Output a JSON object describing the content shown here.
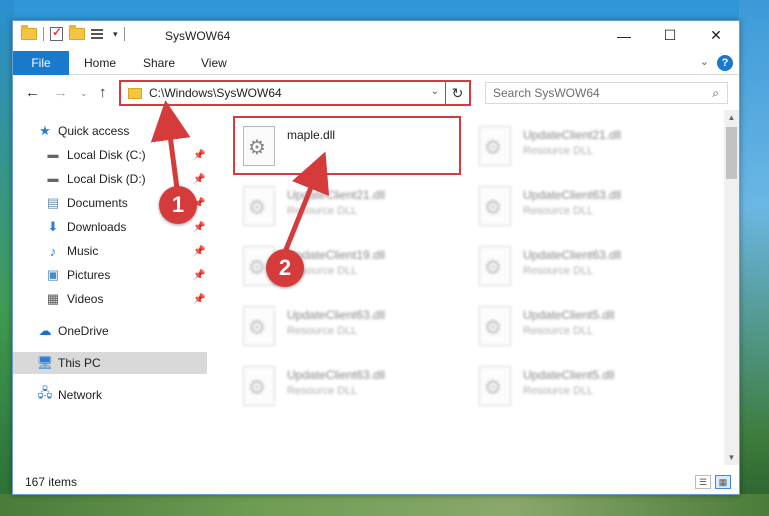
{
  "window": {
    "title": "SysWOW64",
    "controls": {
      "minimize": "—",
      "maximize": "☐",
      "close": "✕"
    }
  },
  "ribbon": {
    "tabs": [
      "File",
      "Home",
      "Share",
      "View"
    ],
    "collapse": "⌄",
    "help": "?"
  },
  "nav": {
    "back": "←",
    "forward": "→",
    "recent": "⌄",
    "up": "↑"
  },
  "address": {
    "path": "C:\\Windows\\SysWOW64",
    "dropdown": "⌄",
    "refresh": "↻"
  },
  "search": {
    "placeholder": "Search SysWOW64"
  },
  "sidebar": {
    "items": [
      {
        "label": "Quick access",
        "icon": "star-icon"
      },
      {
        "label": "Local Disk (C:)",
        "icon": "drive-icon"
      },
      {
        "label": "Local Disk (D:)",
        "icon": "drive-icon"
      },
      {
        "label": "Documents",
        "icon": "documents-icon"
      },
      {
        "label": "Downloads",
        "icon": "download-icon"
      },
      {
        "label": "Music",
        "icon": "music-icon"
      },
      {
        "label": "Pictures",
        "icon": "pictures-icon"
      },
      {
        "label": "Videos",
        "icon": "videos-icon"
      },
      {
        "label": "OneDrive",
        "icon": "cloud-icon"
      },
      {
        "label": "This PC",
        "icon": "computer-icon",
        "selected": true
      },
      {
        "label": "Network",
        "icon": "network-icon"
      }
    ]
  },
  "files": [
    {
      "name": "maple.dll",
      "type": ""
    },
    {
      "name": "UpdateClient21.dll",
      "type": "Resource DLL"
    },
    {
      "name": "UpdateClient21.dll",
      "type": "Resource DLL"
    },
    {
      "name": "UpdateClient63.dll",
      "type": "Resource DLL"
    },
    {
      "name": "UpdateClient19.dll",
      "type": "Resource DLL"
    },
    {
      "name": "UpdateClient63.dll",
      "type": "Resource DLL"
    },
    {
      "name": "UpdateClient63.dll",
      "type": "Resource DLL"
    },
    {
      "name": "UpdateClient5.dll",
      "type": "Resource DLL"
    },
    {
      "name": "UpdateClient63.dll",
      "type": "Resource DLL"
    },
    {
      "name": "UpdateClient5.dll",
      "type": "Resource DLL"
    }
  ],
  "status": {
    "item_count": "167 items"
  },
  "annotations": {
    "markers": [
      "1",
      "2"
    ],
    "color": "#d63b3b"
  },
  "colors": {
    "accent": "#1979ca",
    "highlight": "#d63b3b",
    "selected_bg": "#d9d9d9"
  }
}
